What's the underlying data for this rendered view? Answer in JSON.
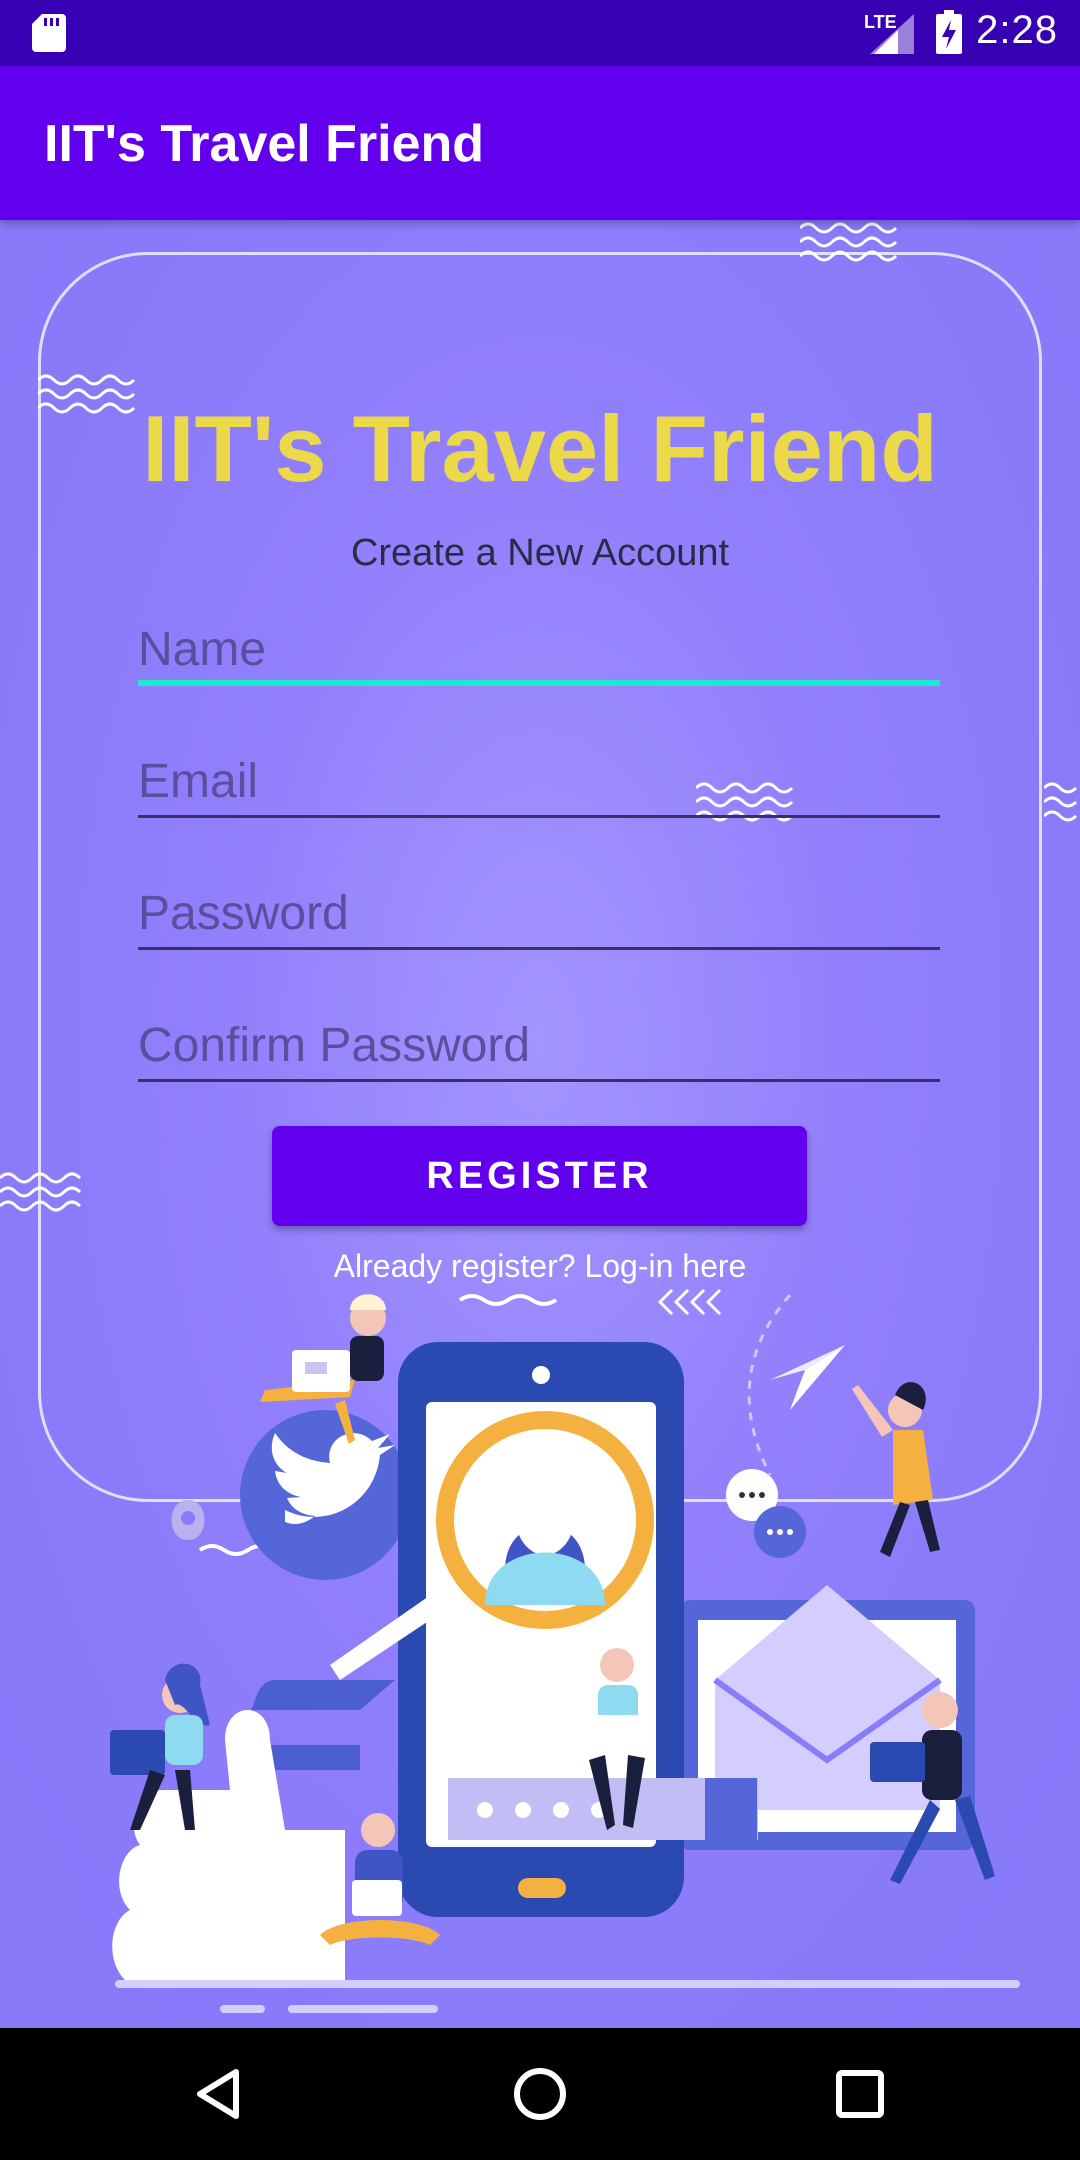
{
  "status_bar": {
    "time": "2:28",
    "network": "LTE"
  },
  "app_bar": {
    "title": "IIT's Travel Friend"
  },
  "form": {
    "heading": "IIT's Travel Friend",
    "subheading": "Create a New Account",
    "name_placeholder": "Name",
    "email_placeholder": "Email",
    "password_placeholder": "Password",
    "confirm_password_placeholder": "Confirm Password",
    "register_label": "REGISTER",
    "login_link": "Already register? Log-in here"
  },
  "colors": {
    "status_bar": "#3700b3",
    "app_bar": "#6200ee",
    "background": "#8a7bfb",
    "heading": "#ecd94a",
    "active_underline": "#1de9d0"
  },
  "icons": [
    "sd-card-icon",
    "lte-signal-icon",
    "battery-charging-icon",
    "back-icon",
    "home-icon",
    "recents-icon"
  ]
}
